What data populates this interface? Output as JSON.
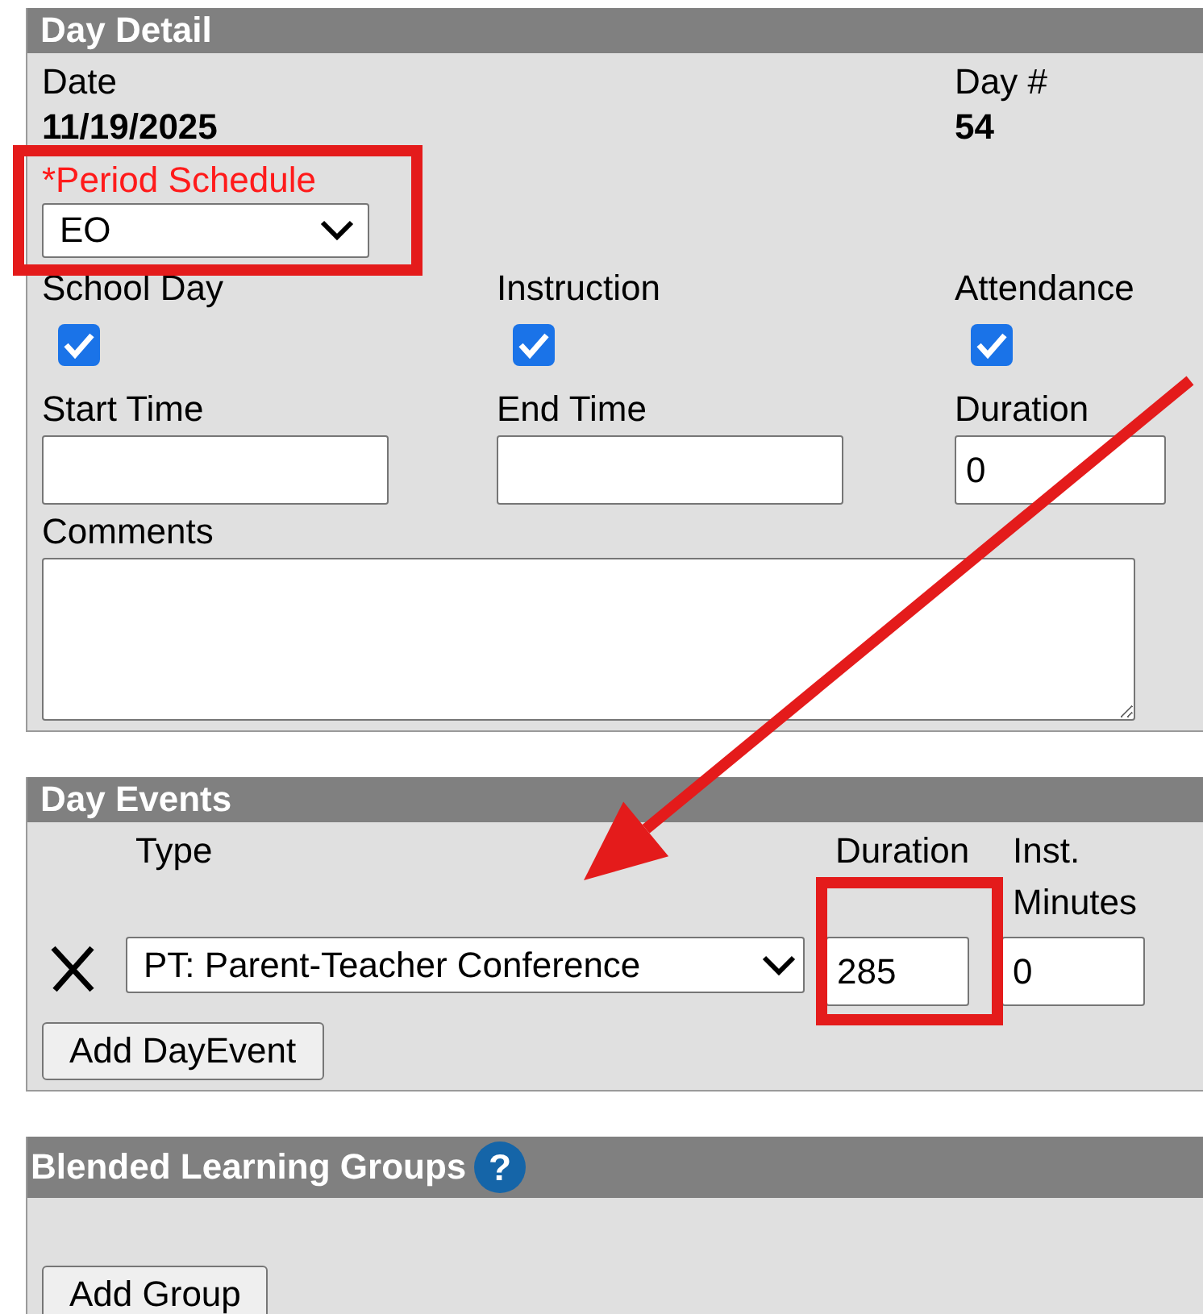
{
  "day_detail": {
    "title": "Day Detail",
    "date": {
      "label": "Date",
      "value": "11/19/2025"
    },
    "day_number": {
      "label": "Day #",
      "value": "54"
    },
    "period_schedule": {
      "label": "*Period Schedule",
      "required": true,
      "value": "EO"
    },
    "flags": [
      {
        "label": "School Day",
        "checked": true
      },
      {
        "label": "Instruction",
        "checked": true
      },
      {
        "label": "Attendance",
        "checked": true
      }
    ],
    "times": [
      {
        "label": "Start Time"
      },
      {
        "label": "End Time"
      },
      {
        "label": "Duration",
        "value": "0"
      }
    ],
    "comments": {
      "label": "Comments"
    }
  },
  "day_events": {
    "title": "Day Events",
    "columns": [
      "Type",
      "Duration",
      "Inst. Minutes"
    ],
    "rows": [
      {
        "type": "PT: Parent-Teacher Conference",
        "duration": "285",
        "inst_minutes": "0"
      }
    ],
    "add_button": "Add DayEvent"
  },
  "blended_learning_groups": {
    "title": "Blended Learning Groups",
    "help_icon": "?",
    "add_button": "Add Group"
  },
  "annotations": [
    {
      "kind": "highlight"
    },
    {
      "kind": "highlight"
    },
    {
      "kind": "arrow"
    }
  ]
}
